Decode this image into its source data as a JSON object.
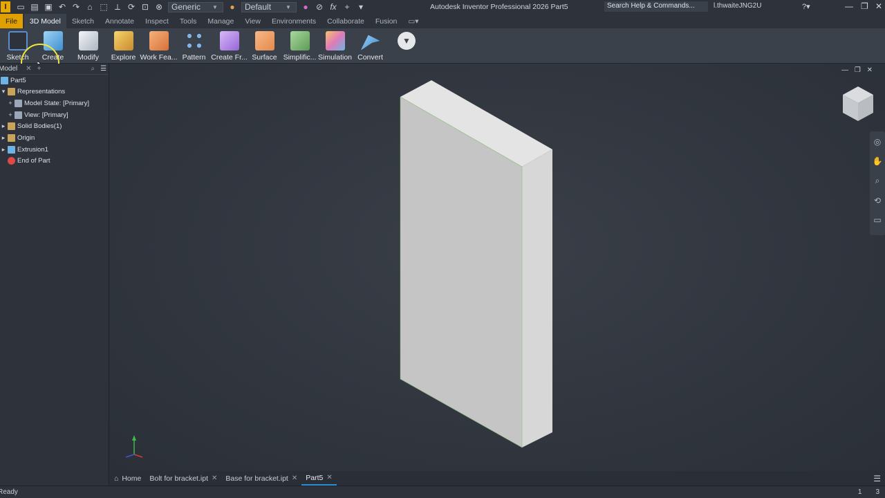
{
  "app": {
    "logo": "I",
    "title": "Autodesk Inventor Professional 2026   Part5",
    "search_placeholder": "Search Help & Commands...",
    "user": "l.thwaiteJNG2U",
    "material": "Generic",
    "appearance": "Default"
  },
  "ribbon_tabs": [
    "File",
    "3D Model",
    "Sketch",
    "Annotate",
    "Inspect",
    "Tools",
    "Manage",
    "View",
    "Environments",
    "Collaborate",
    "Fusion"
  ],
  "ribbon_buttons": [
    {
      "label": "Sketch",
      "icon": "sketch-icon",
      "color": "#5a8cd0"
    },
    {
      "label": "Create",
      "icon": "create-icon",
      "color": "#6fb3e6"
    },
    {
      "label": "Modify",
      "icon": "modify-icon",
      "color": "#d7dde6"
    },
    {
      "label": "Explore",
      "icon": "explore-icon",
      "color": "#e3b34a"
    },
    {
      "label": "Work Fea...",
      "icon": "work-features-icon",
      "color": "#e8914a"
    },
    {
      "label": "Pattern",
      "icon": "pattern-icon",
      "color": "#6aa0e0"
    },
    {
      "label": "Create Fr...",
      "icon": "create-freeform-icon",
      "color": "#b58ae6"
    },
    {
      "label": "Surface",
      "icon": "surface-icon",
      "color": "#f0a060"
    },
    {
      "label": "Simplific...",
      "icon": "simplification-icon",
      "color": "#7cba72"
    },
    {
      "label": "Simulation",
      "icon": "simulation-icon",
      "color": "#e6a0c8"
    },
    {
      "label": "Convert",
      "icon": "convert-icon",
      "color": "#5fa8e8"
    }
  ],
  "browser": {
    "title": "Model",
    "items": [
      {
        "label": "Part5",
        "indent": 0,
        "expander": "",
        "icon_color": "#6fb3e6"
      },
      {
        "label": "Representations",
        "indent": 1,
        "expander": "▾",
        "icon_color": "#c8a45a"
      },
      {
        "label": "Model State: [Primary]",
        "indent": 2,
        "expander": "+",
        "icon_color": "#9aa7b8"
      },
      {
        "label": "View: [Primary]",
        "indent": 2,
        "expander": "+",
        "icon_color": "#9aa7b8"
      },
      {
        "label": "Solid Bodies(1)",
        "indent": 1,
        "expander": "▸",
        "icon_color": "#c8a45a"
      },
      {
        "label": "Origin",
        "indent": 1,
        "expander": "▸",
        "icon_color": "#c8a45a"
      },
      {
        "label": "Extrusion1",
        "indent": 1,
        "expander": "▸",
        "icon_color": "#6fb3e6"
      },
      {
        "label": "End of Part",
        "indent": 1,
        "expander": "",
        "icon_color": "#e04848"
      }
    ]
  },
  "doc_tabs": [
    {
      "label": "Home",
      "closable": false
    },
    {
      "label": "Bolt for bracket.ipt",
      "closable": true
    },
    {
      "label": "Base for bracket.ipt",
      "closable": true
    },
    {
      "label": "Part5",
      "closable": true
    }
  ],
  "status": {
    "text": "Ready",
    "right_1": "1",
    "right_2": "3"
  },
  "viewcube": {
    "face": "viewcube-icon"
  }
}
